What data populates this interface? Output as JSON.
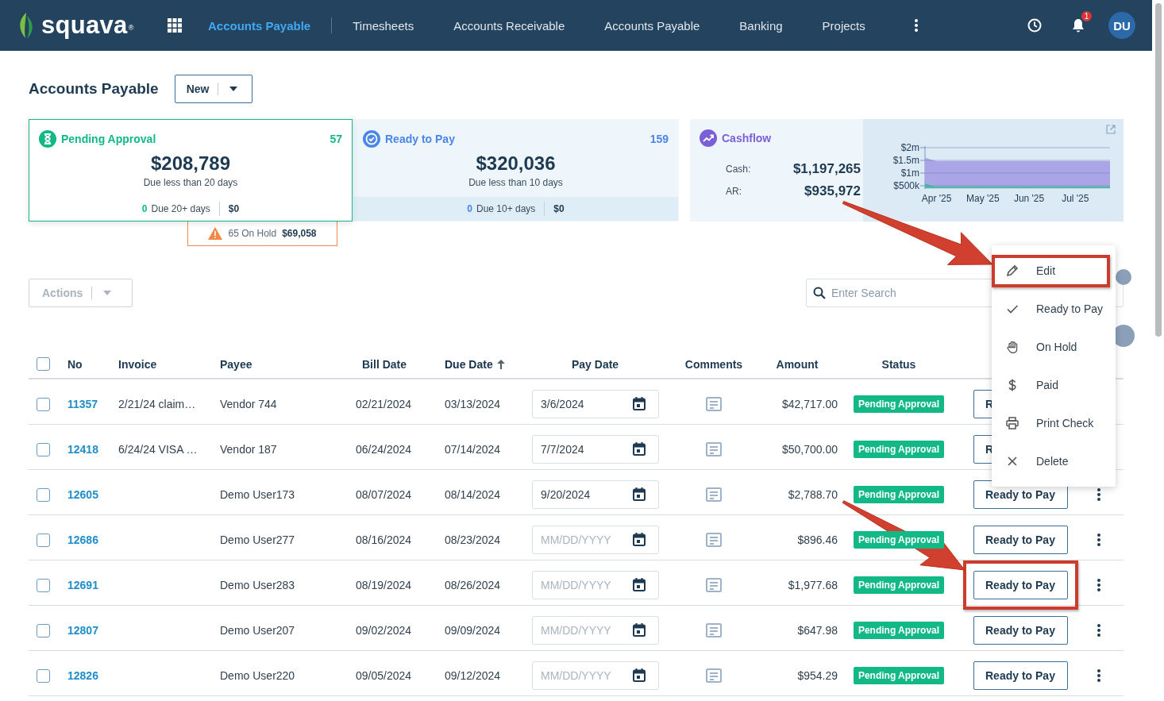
{
  "app": {
    "logo": "squava",
    "logo_mark": "®"
  },
  "nav": [
    {
      "label": "Accounts Payable",
      "selected": true
    },
    {
      "label": "Timesheets",
      "selected": false
    },
    {
      "label": "Accounts Receivable",
      "selected": false
    },
    {
      "label": "Accounts Payable",
      "selected": false
    },
    {
      "label": "Banking",
      "selected": false
    },
    {
      "label": "Projects",
      "selected": false
    }
  ],
  "notifications": {
    "count": "1"
  },
  "user": {
    "initials": "DU"
  },
  "page": {
    "title": "Accounts Payable",
    "new_button": "New"
  },
  "summary_cards": [
    {
      "title": "Pending Approval",
      "count": "57",
      "amount": "$208,789",
      "subtitle": "Due less than 20 days",
      "footer_count": "0",
      "footer_label": "Due 20+ days",
      "footer_amount": "$0",
      "color": "#12b886",
      "selected": true
    },
    {
      "title": "Ready to Pay",
      "count": "159",
      "amount": "$320,036",
      "subtitle": "Due less than 10 days",
      "footer_count": "0",
      "footer_label": "Due 10+ days",
      "footer_amount": "$0",
      "color": "#4a86e8",
      "selected": false
    }
  ],
  "on_hold": {
    "label": "65 On Hold",
    "amount": "$69,058"
  },
  "cashflow": {
    "title": "Cashflow",
    "rows": [
      {
        "label": "Cash:",
        "value": "$1,197,265"
      },
      {
        "label": "AR:",
        "value": "$935,972"
      }
    ],
    "chart_data": {
      "type": "area",
      "stacked": true,
      "grid": true,
      "categories": [
        null,
        "Apr '25",
        null,
        null,
        null,
        "May '25",
        null,
        null,
        null,
        "Jun '25",
        null,
        null,
        null,
        "Jul '25",
        null,
        null,
        null
      ],
      "ylim": [
        400000,
        2000000
      ],
      "yticks": [
        {
          "value": 500000,
          "label": "$500k"
        },
        {
          "value": 1000000,
          "label": "$1m"
        },
        {
          "value": 1500000,
          "label": "$1.5m"
        },
        {
          "value": 2000000,
          "label": "$2m"
        }
      ],
      "series": [
        {
          "color": "#4fb8a8",
          "values": [
            600000,
            470000,
            470000,
            470000,
            470000,
            470000,
            470000,
            470000,
            470000,
            470000,
            470000,
            470000,
            470000,
            470000,
            470000,
            470000,
            470000
          ]
        },
        {
          "color": "#a9a5e6",
          "values": [
            1000000,
            1000000,
            1000000,
            1000000,
            1000000,
            1000000,
            1000000,
            1000000,
            1000000,
            1000000,
            1000000,
            1000000,
            1000000,
            1000000,
            1000000,
            1000000,
            1000000
          ]
        }
      ]
    }
  },
  "actions": {
    "label": "Actions",
    "disabled": true
  },
  "search": {
    "placeholder": "Enter Search"
  },
  "table": {
    "select_all": false,
    "columns": [
      {
        "label": "No",
        "sorted": false
      },
      {
        "label": "Invoice",
        "sorted": false
      },
      {
        "label": "Payee",
        "sorted": false
      },
      {
        "label": "Bill Date",
        "sorted": false
      },
      {
        "label": "Due Date",
        "sorted": true
      },
      {
        "label": "Pay Date",
        "sorted": false
      },
      {
        "label": "Comments",
        "sorted": false
      },
      {
        "label": "Amount",
        "sorted": false
      },
      {
        "label": "Status",
        "sorted": false
      }
    ],
    "rows": [
      {
        "checked": false,
        "no": "11357",
        "invoice": "2/21/24 claim…",
        "payee": "Vendor 744",
        "bill_date": "02/21/2024",
        "due_date": "03/13/2024",
        "pay_date": "3/6/2024",
        "amount": "$42,717.00",
        "status": "Pending Approval",
        "action": "R",
        "highlighted": false
      },
      {
        "checked": false,
        "no": "12418",
        "invoice": "6/24/24 VISA …",
        "payee": "Vendor 187",
        "bill_date": "06/24/2024",
        "due_date": "07/14/2024",
        "pay_date": "7/7/2024",
        "amount": "$50,700.00",
        "status": "Pending Approval",
        "action": "R",
        "highlighted": false
      },
      {
        "checked": false,
        "no": "12605",
        "payee": "Demo User173",
        "bill_date": "08/07/2024",
        "due_date": "08/14/2024",
        "pay_date": "9/20/2024",
        "amount": "$2,788.70",
        "status": "Pending Approval",
        "action": "Ready to Pay",
        "highlighted": false
      },
      {
        "checked": false,
        "no": "12686",
        "payee": "Demo User277",
        "bill_date": "08/16/2024",
        "due_date": "08/23/2024",
        "pay_placeholder": "MM/DD/YYYY",
        "amount": "$896.46",
        "status": "Pending Approval",
        "action": "Ready to Pay",
        "highlighted": false
      },
      {
        "checked": false,
        "no": "12691",
        "payee": "Demo User283",
        "bill_date": "08/19/2024",
        "due_date": "08/26/2024",
        "pay_placeholder": "MM/DD/YYYY",
        "amount": "$1,977.68",
        "status": "Pending Approval",
        "action": "Ready to Pay",
        "highlighted": true
      },
      {
        "checked": false,
        "no": "12807",
        "payee": "Demo User207",
        "bill_date": "09/02/2024",
        "due_date": "09/09/2024",
        "pay_placeholder": "MM/DD/YYYY",
        "amount": "$647.98",
        "status": "Pending Approval",
        "action": "Ready to Pay",
        "highlighted": false
      },
      {
        "checked": false,
        "no": "12826",
        "payee": "Demo User220",
        "bill_date": "09/05/2024",
        "due_date": "09/12/2024",
        "pay_placeholder": "MM/DD/YYYY",
        "amount": "$954.29",
        "status": "Pending Approval",
        "action": "Ready to Pay",
        "highlighted": false
      }
    ]
  },
  "row_menu": {
    "items": [
      {
        "label": "Edit",
        "highlighted": true
      },
      {
        "label": "Ready to Pay",
        "highlighted": false
      },
      {
        "label": "On Hold",
        "highlighted": false
      },
      {
        "label": "Paid",
        "highlighted": false
      },
      {
        "label": "Print Check",
        "highlighted": false
      },
      {
        "label": "Delete",
        "highlighted": false
      }
    ]
  }
}
